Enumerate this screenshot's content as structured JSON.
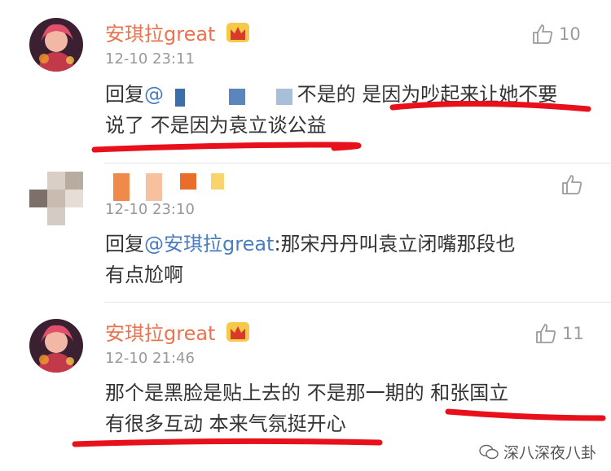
{
  "comments": [
    {
      "username": "安琪拉great",
      "time": "12-10 23:11",
      "reply_prefix": "回复",
      "mention": "@",
      "text_line1": "不是的 是因为吵起来让她不要",
      "text_line2": "说了 不是因为袁立谈公益",
      "likes": "10"
    },
    {
      "time": "12-10 23:10",
      "reply_prefix": "回复",
      "mention": "@安琪拉great",
      "text_line1": ":那宋丹丹叫袁立闭嘴那段也",
      "text_line2": "有点尬啊"
    },
    {
      "username": "安琪拉great",
      "time": "12-10 21:46",
      "text_line1": "那个是黑脸是贴上去的 不是那一期的 和张国立",
      "text_line2": "有很多互动 本来气氛挺开心",
      "likes": "11"
    }
  ],
  "watermark": {
    "text": "深八深夜八卦"
  },
  "colors": {
    "username": "#eb7350",
    "mention": "#4a7dbf",
    "underline": "#e8101a"
  }
}
